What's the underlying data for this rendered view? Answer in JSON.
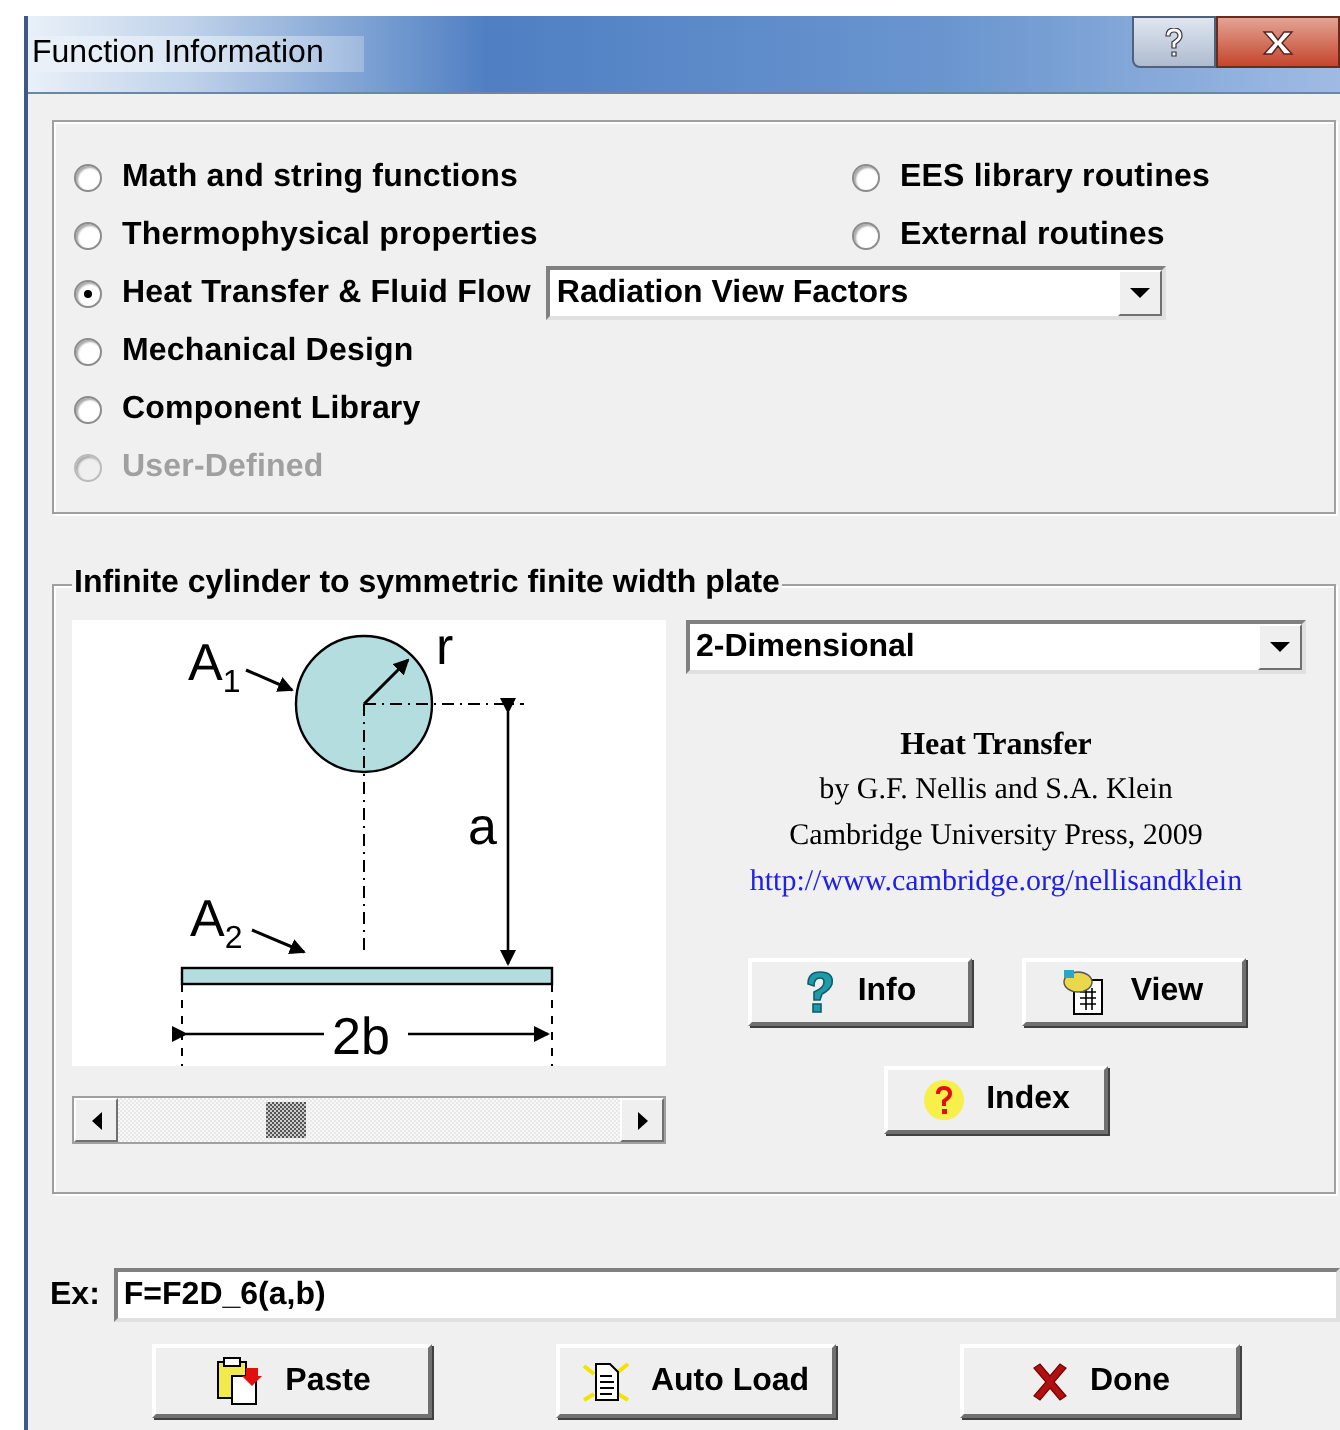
{
  "window": {
    "title": "Function Information"
  },
  "categories": [
    {
      "label": "Math and string functions",
      "selected": false,
      "disabled": false
    },
    {
      "label": "Thermophysical properties",
      "selected": false,
      "disabled": false
    },
    {
      "label": "Heat Transfer & Fluid Flow",
      "selected": true,
      "disabled": false
    },
    {
      "label": "Mechanical Design",
      "selected": false,
      "disabled": false
    },
    {
      "label": "Component Library",
      "selected": false,
      "disabled": false
    },
    {
      "label": "User-Defined",
      "selected": false,
      "disabled": true
    }
  ],
  "library_categories": [
    {
      "label": "EES library routines",
      "selected": false,
      "disabled": false
    },
    {
      "label": "External routines",
      "selected": false,
      "disabled": false
    }
  ],
  "subcategory_select": {
    "value": "Radiation View Factors"
  },
  "function_group": {
    "title": "Infinite cylinder to symmetric finite width plate",
    "diagram": {
      "labels": [
        {
          "kind": "surface1",
          "text": "A$_{1}$"
        },
        {
          "kind": "radius",
          "text": "r"
        },
        {
          "kind": "distance",
          "text": "a"
        },
        {
          "kind": "surface2",
          "text": "A$_{2}$"
        },
        {
          "kind": "width",
          "text": "2b"
        }
      ]
    },
    "dimension_select": {
      "value": "2-Dimensional"
    },
    "book": {
      "title": "Heat Transfer",
      "authors": "by G.F. Nellis and S.A. Klein",
      "publisher": "Cambridge University Press, 2009",
      "url": "http://www.cambridge.org/nellisandklein"
    },
    "buttons": [
      {
        "kind": "info",
        "label": "Info"
      },
      {
        "kind": "view",
        "label": "View"
      },
      {
        "kind": "index",
        "label": "Index"
      }
    ]
  },
  "example": {
    "label": "Ex:",
    "value": "F=F2D_6(a,b)"
  },
  "buttons": [
    {
      "kind": "paste",
      "label": "Paste"
    },
    {
      "kind": "autoload",
      "label": "Auto Load"
    },
    {
      "kind": "done",
      "label": "Done"
    }
  ]
}
